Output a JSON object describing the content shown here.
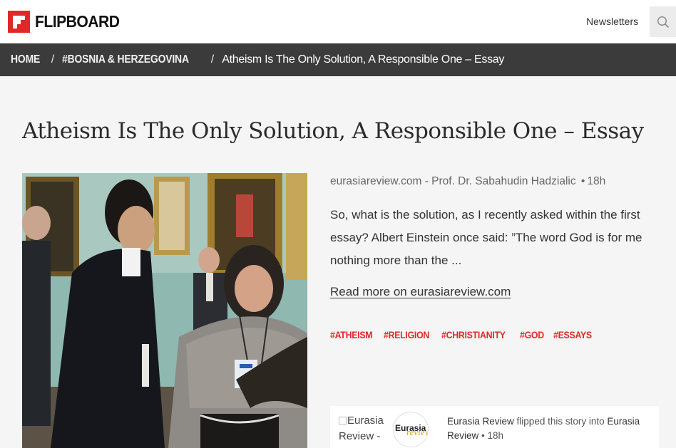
{
  "header": {
    "brand": "FLIPBOARD",
    "newsletters_label": "Newsletters",
    "search_icon": "search-icon"
  },
  "breadcrumb": {
    "home": "HOME",
    "sep1": "/",
    "topic": "#BOSNIA & HERZEGOVINA",
    "sep2": "/",
    "current": "Atheism Is The Only Solution, A Responsible One – Essay"
  },
  "article": {
    "title": "Atheism Is The Only Solution, A Responsible One – Essay",
    "source": "eurasiareview.com - Prof. Dr. Sabahudin Hadzialic",
    "dot": "•",
    "age": "18h",
    "excerpt": "So, what is the solution, as I recently asked within the first essay? Albert Einstein once said: ”The word God is for me nothing more than the ...",
    "read_more": "Read more on eurasiareview.com",
    "tags": [
      "#ATHEISM",
      "#RELIGION",
      "#CHRISTIANITY",
      "#GOD",
      "#ESSAYS"
    ]
  },
  "attribution": {
    "image_alt": "Eurasia Review -",
    "avatar_text_1": "Eurasia",
    "avatar_text_2": "review",
    "flipper": "Eurasia Review",
    "action": " flipped this story into ",
    "magazine": "Eurasia Review",
    "dot": " • ",
    "age": "18h"
  },
  "colors": {
    "brand_red": "#e12828",
    "breadcrumb_bg": "#3b3b3b",
    "page_bg": "#f5f5f5"
  }
}
